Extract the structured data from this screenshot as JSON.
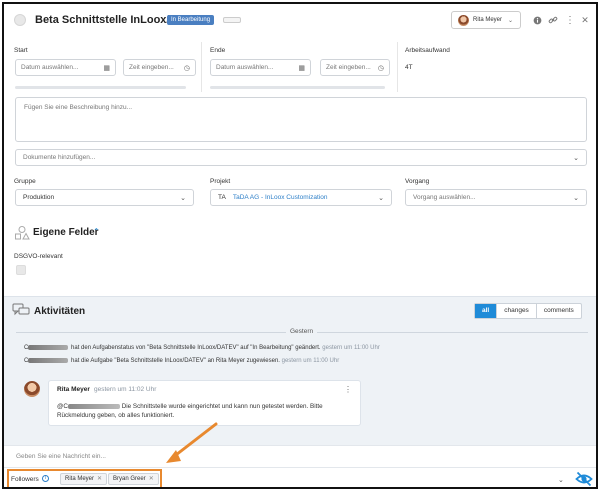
{
  "header": {
    "title": "Beta Schnittstelle InLoox/DATEV",
    "status": "In Bearbeitung",
    "user_name": "Rita Meyer",
    "icons": [
      "check-circle-icon",
      "info-icon",
      "link-icon",
      "more-vertical-icon",
      "close-icon"
    ]
  },
  "dates": {
    "start_label": "Start",
    "end_label": "Ende",
    "effort_label": "Arbeitsaufwand",
    "effort_value": "4T",
    "date_placeholder": "Datum auswählen...",
    "time_placeholder": "Zeit eingeben..."
  },
  "description": {
    "placeholder": "Fügen Sie eine Beschreibung hinzu..."
  },
  "documents": {
    "placeholder": "Dokumente hinzufügen..."
  },
  "fields": {
    "group_label": "Gruppe",
    "group_value": "Produktion",
    "project_label": "Projekt",
    "project_prefix": "TA",
    "project_value": "TaDA AG - InLoox Customization",
    "process_label": "Vorgang",
    "process_placeholder": "Vorgang auswählen..."
  },
  "custom_fields": {
    "title": "Eigene Felder",
    "gdpr_label": "DSGVO-relevant"
  },
  "activities": {
    "title": "Aktivitäten",
    "tabs": [
      {
        "label": "all",
        "active": true
      },
      {
        "label": "changes",
        "active": false
      },
      {
        "label": "comments",
        "active": false
      }
    ],
    "day_label": "Gestern",
    "log": [
      {
        "prefix": "C",
        "text": "hat den Aufgabenstatus von \"Beta Schnittstelle InLoox/DATEV\" auf \"In Bearbeitung\" geändert.",
        "time": "gestern um 11:00 Uhr"
      },
      {
        "prefix": "C",
        "text": "hat die Aufgabe \"Beta Schnittstelle InLoox/DATEV\" an Rita Meyer zugewiesen.",
        "time": "gestern um 11:00 Uhr"
      }
    ],
    "comment": {
      "author": "Rita Meyer",
      "time": "gestern um 11:02 Uhr",
      "mention": "@C",
      "body": "Die Schnittstelle wurde eingerichtet und kann nun getestet werden. Bitte Rückmeldung geben, ob alles funktioniert."
    },
    "message_placeholder": "Geben Sie eine Nachricht ein..."
  },
  "followers": {
    "label": "Followers",
    "people": [
      "Rita Meyer",
      "Bryan Greer"
    ]
  },
  "colors": {
    "status_badge": "#4a7fc1",
    "active_tab": "#1f8bd8",
    "project_link": "#2d7fc8",
    "highlight": "#e8892f"
  }
}
